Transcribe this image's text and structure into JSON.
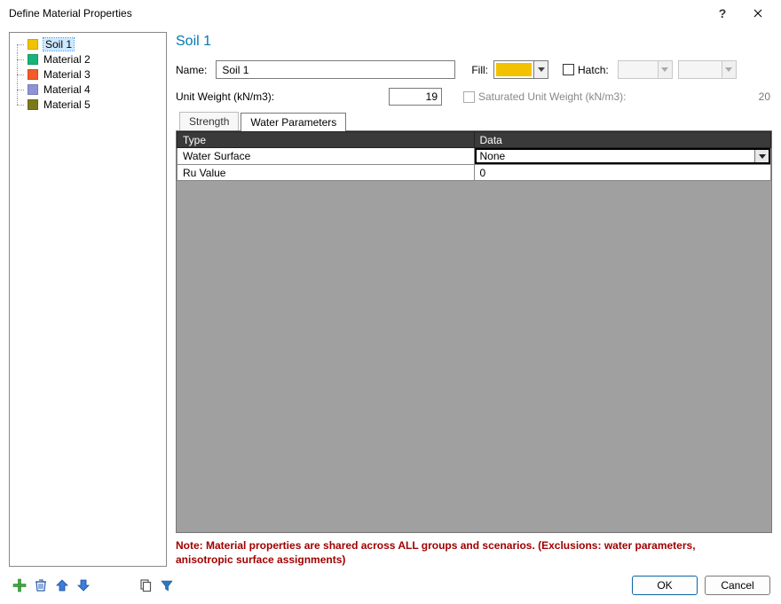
{
  "window": {
    "title": "Define Material Properties"
  },
  "materials": [
    {
      "label": "Soil 1",
      "color": "#f2c200",
      "selected": true
    },
    {
      "label": "Material 2",
      "color": "#19b37a",
      "selected": false
    },
    {
      "label": "Material 3",
      "color": "#f25b2a",
      "selected": false
    },
    {
      "label": "Material 4",
      "color": "#8f93d6",
      "selected": false
    },
    {
      "label": "Material 5",
      "color": "#7a7a1a",
      "selected": false
    }
  ],
  "editor": {
    "heading": "Soil 1",
    "name_label": "Name:",
    "name_value": "Soil 1",
    "fill_label": "Fill:",
    "fill_color": "#f2c200",
    "hatch_label": "Hatch:",
    "hatch_checked": false,
    "unit_weight_label": "Unit Weight (kN/m3):",
    "unit_weight_value": "19",
    "sat_unit_weight_label": "Saturated Unit Weight (kN/m3):",
    "sat_unit_weight_value": "20",
    "sat_unit_weight_enabled": false
  },
  "tabs": [
    {
      "label": "Strength",
      "active": false
    },
    {
      "label": "Water Parameters",
      "active": true
    }
  ],
  "grid": {
    "col_type": "Type",
    "col_data": "Data",
    "rows": [
      {
        "type": "Water Surface",
        "data": "None",
        "dropdown": true
      },
      {
        "type": "Ru Value",
        "data": "0",
        "dropdown": false
      }
    ]
  },
  "note": "Note: Material properties are shared across ALL groups and scenarios. (Exclusions: water parameters, anisotropic surface assignments)",
  "buttons": {
    "ok": "OK",
    "cancel": "Cancel"
  },
  "toolbar_icons": {
    "add": "add-icon",
    "delete": "trash-icon",
    "up": "arrow-up-icon",
    "down": "arrow-down-icon",
    "copy": "copy-icon",
    "filter": "filter-icon"
  }
}
